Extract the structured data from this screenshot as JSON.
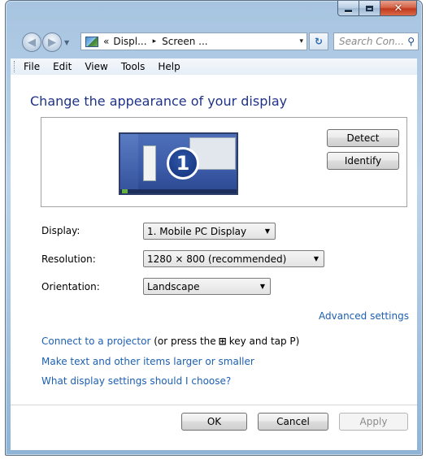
{
  "window": {
    "controls": {
      "minimize": "minimize-icon",
      "maximize": "maximize-icon",
      "close": "close-icon",
      "close_glyph": "✕"
    }
  },
  "navbar": {
    "back_icon": "back-arrow-icon",
    "forward_icon": "forward-arrow-icon",
    "address": {
      "prefix": "«",
      "crumbs": [
        "Displ...",
        "Screen ..."
      ],
      "separator": "▸",
      "dropdown": "▾"
    },
    "refresh_glyph": "↻",
    "search_placeholder": "Search Con...",
    "search_glyph": "⚲"
  },
  "menu": [
    "File",
    "Edit",
    "View",
    "Tools",
    "Help"
  ],
  "main": {
    "heading": "Change the appearance of your display",
    "monitor_number": "1",
    "detect_label": "Detect",
    "identify_label": "Identify",
    "display_label": "Display:",
    "display_value": "1. Mobile PC Display",
    "resolution_label": "Resolution:",
    "resolution_value": "1280 × 800 (recommended)",
    "orientation_label": "Orientation:",
    "orientation_value": "Landscape",
    "advanced_link": "Advanced settings",
    "projector_link": "Connect to a projector",
    "projector_tail_before": "(or press the",
    "projector_tail_after": "key and tap P)",
    "text_size_link": "Make text and other items larger or smaller",
    "which_settings_link": "What display settings should I choose?"
  },
  "footer": {
    "ok": "OK",
    "cancel": "Cancel",
    "apply": "Apply"
  },
  "colors": {
    "link": "#1c5fb1",
    "heading": "#1e3287",
    "close_button": "#c0391d"
  }
}
